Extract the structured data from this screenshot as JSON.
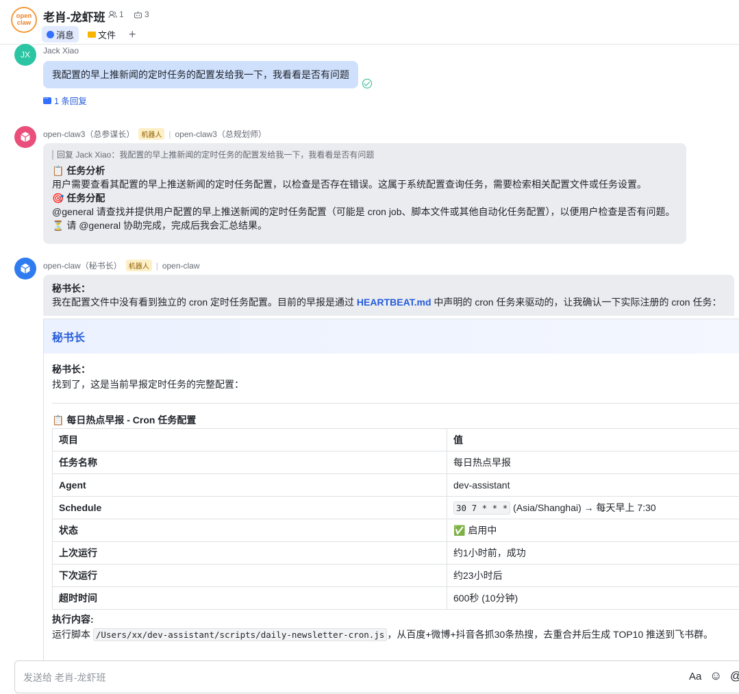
{
  "header": {
    "avatar_text": "open\nclaw",
    "title": "老肖-龙虾班",
    "member_count": "1",
    "bot_count": "3",
    "tabs": [
      {
        "label": "消息",
        "active": true
      },
      {
        "label": "文件",
        "active": false
      }
    ]
  },
  "messages": [
    {
      "avatar_initials": "JX",
      "sender": "Jack Xiao",
      "text": "我配置的早上推新闻的定时任务的配置发给我一下，我看看是否有问题",
      "reply_count": "1 条回复"
    },
    {
      "sender": "open-claw3（总参谋长）",
      "tag": "机器人",
      "alt_name": "open-claw3（总规划师）",
      "quote": "回复 Jack Xiao：我配置的早上推新闻的定时任务的配置发给我一下，我看看是否有问题",
      "lines": [
        "📋 任务分析",
        "用户需要查看其配置的早上推送新闻的定时任务配置，以检查是否存在错误。这属于系统配置查询任务，需要检索相关配置文件或任务设置。",
        "🎯 任务分配",
        "@general 请查找并提供用户配置的早上推送新闻的定时任务配置（可能是 cron job、脚本文件或其他自动化任务配置），以便用户检查是否有问题。",
        "⏳ 请 @general 协助完成，完成后我会汇总结果。"
      ]
    },
    {
      "sender": "open-claw（秘书长）",
      "tag": "机器人",
      "alt_name": "open-claw",
      "intro_label": "秘书长：",
      "intro_pre": "我在配置文件中没有看到独立的 cron 定时任务配置。目前的早报是通过 ",
      "intro_link": "HEARTBEAT.md",
      "intro_post": " 中声明的 cron 任务来驱动的，让我确认一下实际注册的 cron 任务：",
      "card": {
        "title": "秘书长",
        "label": "秘书长：",
        "found": "找到了，这是当前早报定时任务的完整配置：",
        "table_title": "📋 每日热点早报 - Cron 任务配置",
        "columns": [
          "项目",
          "值"
        ],
        "rows": [
          {
            "k": "任务名称",
            "v": "每日热点早报"
          },
          {
            "k": "Agent",
            "v": "dev-assistant"
          },
          {
            "k": "Schedule",
            "code": "30 7 * * *",
            "v": " (Asia/Shanghai) → 每天早上 7:30"
          },
          {
            "k": "状态",
            "v": "✅ 启用中"
          },
          {
            "k": "上次运行",
            "v": "约1小时前，成功"
          },
          {
            "k": "下次运行",
            "v": "约23小时后"
          },
          {
            "k": "超时时间",
            "v": "600秒 (10分钟)"
          }
        ],
        "exec_title": "执行内容:",
        "exec_pre": "运行脚本 ",
        "exec_code": "/Users/xx/dev-assistant/scripts/daily-newsletter-cron.js",
        "exec_post": "，从百度+微博+抖音各抓30条热搜，去重合并后生成 TOP10 推送到飞书群。"
      }
    }
  ],
  "composer": {
    "placeholder": "发送给 老肖-龙虾班",
    "format_icon": "Aa",
    "emoji_icon": "☺",
    "mention_icon": "@"
  }
}
